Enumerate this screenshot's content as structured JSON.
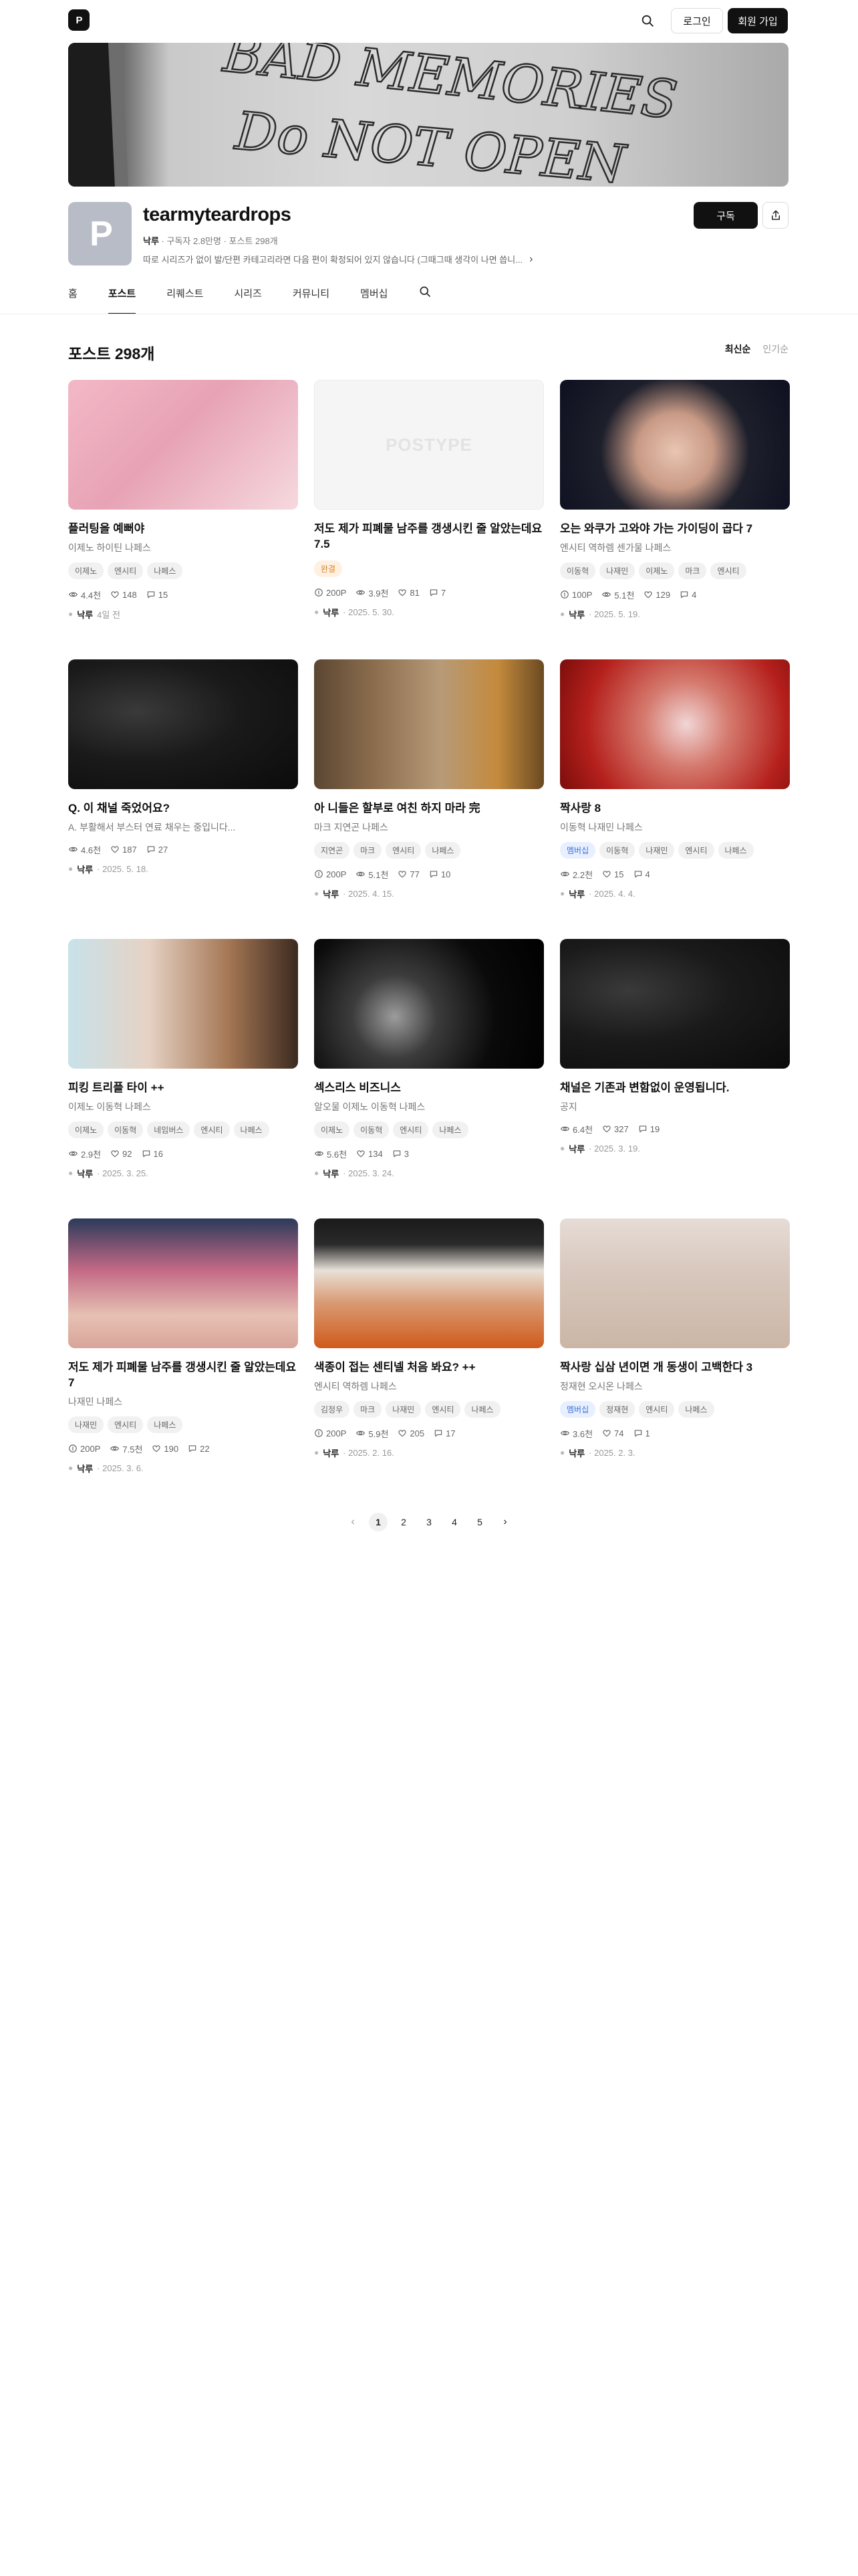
{
  "header": {
    "logo_text": "P",
    "login_label": "로그인",
    "signup_label": "회원 가입"
  },
  "banner": {
    "text_line1": "BAD MEMORIES",
    "text_line2": "Do NOT OPEN"
  },
  "profile": {
    "avatar_text": "P",
    "name": "tearmyteardrops",
    "owner": "낙루",
    "meta": "· 구독자 2.8만명 · 포스트 298개",
    "description": "따로 시리즈가 없이 발/단편 카테고리라면 다음 편이 확정되어 있지 않습니다 (그때그때 생각이 나면 씁니...",
    "subscribe_label": "구독"
  },
  "tabs": [
    "홈",
    "포스트",
    "리퀘스트",
    "시리즈",
    "커뮤니티",
    "멤버십"
  ],
  "active_tab": 1,
  "section": {
    "title": "포스트 298개",
    "sort_latest": "최신순",
    "sort_popular": "인기순"
  },
  "posts": [
    {
      "title": "플러팅을 예뻐야",
      "sub": "이제노 하이틴 나페스",
      "tags": [
        {
          "t": "이제노",
          "s": "gray"
        },
        {
          "t": "엔시티",
          "s": "gray"
        },
        {
          "t": "나페스",
          "s": "gray"
        }
      ],
      "price": "",
      "views": "4.4천",
      "likes": "148",
      "comments": "15",
      "author": "낙루",
      "date": "4일 전"
    },
    {
      "title": "저도 제가 피폐물 남주를 갱생시킨 줄 알았는데요 7.5",
      "sub": "",
      "tags": [
        {
          "t": "완결",
          "s": "orange"
        }
      ],
      "price": "200P",
      "views": "3.9천",
      "likes": "81",
      "comments": "7",
      "author": "낙루",
      "date": "· 2025. 5. 30."
    },
    {
      "title": "오는 와쿠가 고와야 가는 가이딩이 곱다 7",
      "sub": "엔시티 역하렘 센가물 나페스",
      "tags": [
        {
          "t": "이동혁",
          "s": "gray"
        },
        {
          "t": "나재민",
          "s": "gray"
        },
        {
          "t": "이제노",
          "s": "gray"
        },
        {
          "t": "마크",
          "s": "gray"
        },
        {
          "t": "엔시티",
          "s": "gray"
        }
      ],
      "price": "100P",
      "views": "5.1천",
      "likes": "129",
      "comments": "4",
      "author": "낙루",
      "date": "· 2025. 5. 19."
    },
    {
      "title": "Q. 이 채널 죽었어요?",
      "sub": "A. 부활해서 부스터 연료 채우는 중입니다...",
      "tags": [],
      "price": "",
      "views": "4.6천",
      "likes": "187",
      "comments": "27",
      "author": "낙루",
      "date": "· 2025. 5. 18."
    },
    {
      "title": "아 니들은 할부로 여친 하지 마라 完",
      "sub": "마크 지연곤 나페스",
      "tags": [
        {
          "t": "지연곤",
          "s": "gray"
        },
        {
          "t": "마크",
          "s": "gray"
        },
        {
          "t": "엔시티",
          "s": "gray"
        },
        {
          "t": "나페스",
          "s": "gray"
        }
      ],
      "price": "200P",
      "views": "5.1천",
      "likes": "77",
      "comments": "10",
      "author": "낙루",
      "date": "· 2025. 4. 15."
    },
    {
      "title": "짝사랑 8",
      "sub": "이동혁 나재민 나페스",
      "tags": [
        {
          "t": "멤버십",
          "s": "blue"
        },
        {
          "t": "이동혁",
          "s": "gray"
        },
        {
          "t": "나재민",
          "s": "gray"
        },
        {
          "t": "엔시티",
          "s": "gray"
        },
        {
          "t": "나페스",
          "s": "gray"
        }
      ],
      "price": "",
      "views": "2.2천",
      "likes": "15",
      "comments": "4",
      "author": "낙루",
      "date": "· 2025. 4. 4."
    },
    {
      "title": "피킹 트리플 타이 ++",
      "sub": "이제노 이동혁 나페스",
      "tags": [
        {
          "t": "이제노",
          "s": "gray"
        },
        {
          "t": "이동혁",
          "s": "gray"
        },
        {
          "t": "네임버스",
          "s": "gray"
        },
        {
          "t": "엔시티",
          "s": "gray"
        },
        {
          "t": "나페스",
          "s": "gray"
        }
      ],
      "price": "",
      "views": "2.9천",
      "likes": "92",
      "comments": "16",
      "author": "낙루",
      "date": "· 2025. 3. 25."
    },
    {
      "title": "섹스리스 비즈니스",
      "sub": "알오물 이제노 이동혁 나페스",
      "tags": [
        {
          "t": "이제노",
          "s": "gray"
        },
        {
          "t": "이동혁",
          "s": "gray"
        },
        {
          "t": "엔시티",
          "s": "gray"
        },
        {
          "t": "나페스",
          "s": "gray"
        }
      ],
      "price": "",
      "views": "5.6천",
      "likes": "134",
      "comments": "3",
      "author": "낙루",
      "date": "· 2025. 3. 24."
    },
    {
      "title": "채널은 기존과 변함없이 운영됩니다.",
      "sub": "공지",
      "tags": [],
      "price": "",
      "views": "6.4천",
      "likes": "327",
      "comments": "19",
      "author": "낙루",
      "date": "· 2025. 3. 19."
    },
    {
      "title": "저도 제가 피폐물 남주를 갱생시킨 줄 알았는데요 7",
      "sub": "나재민 나페스",
      "tags": [
        {
          "t": "나재민",
          "s": "gray"
        },
        {
          "t": "엔시티",
          "s": "gray"
        },
        {
          "t": "나페스",
          "s": "gray"
        }
      ],
      "price": "200P",
      "views": "7.5천",
      "likes": "190",
      "comments": "22",
      "author": "낙루",
      "date": "· 2025. 3. 6."
    },
    {
      "title": "색종이 접는 센티넬 처음 봐요? ++",
      "sub": "엔시티 역하렘 나페스",
      "tags": [
        {
          "t": "김정우",
          "s": "gray"
        },
        {
          "t": "마크",
          "s": "gray"
        },
        {
          "t": "나재민",
          "s": "gray"
        },
        {
          "t": "엔시티",
          "s": "gray"
        },
        {
          "t": "나페스",
          "s": "gray"
        }
      ],
      "price": "200P",
      "views": "5.9천",
      "likes": "205",
      "comments": "17",
      "author": "낙루",
      "date": "· 2025. 2. 16."
    },
    {
      "title": "짝사랑 십삼 년이면 개 동생이 고백한다 3",
      "sub": "정재현 오시온 나페스",
      "tags": [
        {
          "t": "멤버십",
          "s": "blue"
        },
        {
          "t": "정재현",
          "s": "gray"
        },
        {
          "t": "엔시티",
          "s": "gray"
        },
        {
          "t": "나페스",
          "s": "gray"
        }
      ],
      "price": "",
      "views": "3.6천",
      "likes": "74",
      "comments": "1",
      "author": "낙루",
      "date": "· 2025. 2. 3."
    }
  ],
  "placeholder_thumb_text": "POSTYPE",
  "pagination": {
    "pages": [
      "1",
      "2",
      "3",
      "4",
      "5"
    ],
    "current": "1",
    "prev": "‹",
    "next": "›"
  }
}
